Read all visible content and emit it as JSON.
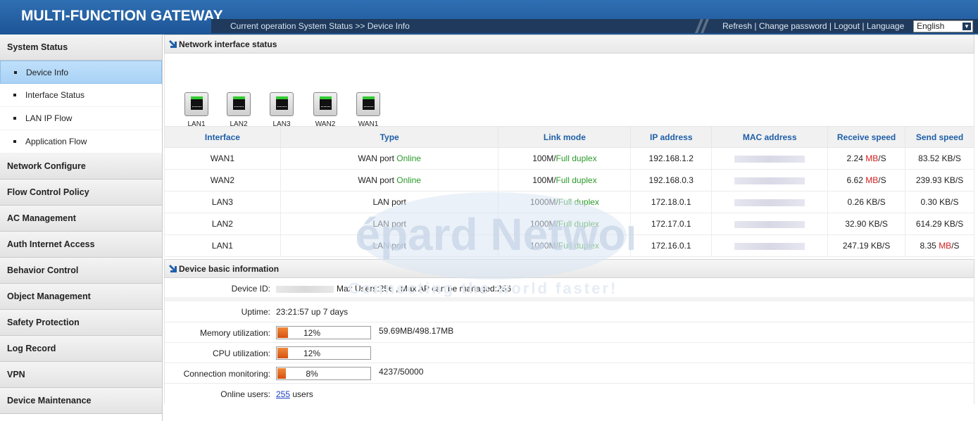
{
  "header": {
    "app_title": "MULTI-FUNCTION GATEWAY",
    "breadcrumb": "Current operation  System Status >> Device Info",
    "links": [
      "Refresh",
      "Change password",
      "Logout",
      "Language"
    ],
    "language_value": "English"
  },
  "sidebar": {
    "groups": [
      {
        "label": "System Status",
        "items": [
          "Device Info",
          "Interface Status",
          "LAN IP Flow",
          "Application Flow"
        ],
        "active": "Device Info"
      },
      {
        "label": "Network Configure"
      },
      {
        "label": "Flow Control Policy"
      },
      {
        "label": "AC Management"
      },
      {
        "label": "Auth Internet Access"
      },
      {
        "label": "Behavior Control"
      },
      {
        "label": "Object Management"
      },
      {
        "label": "Safety Protection"
      },
      {
        "label": "Log Record"
      },
      {
        "label": "VPN"
      },
      {
        "label": "Device Maintenance"
      }
    ]
  },
  "network_status": {
    "title": "Network interface status",
    "ports": [
      "LAN1",
      "LAN2",
      "LAN3",
      "WAN2",
      "WAN1"
    ],
    "columns": [
      "Interface",
      "Type",
      "Link mode",
      "IP address",
      "MAC address",
      "Receive speed",
      "Send speed"
    ],
    "rows": [
      {
        "iface": "WAN1",
        "type": "WAN port",
        "status": "Online",
        "speed": "100M/",
        "duplex": "Full duplex",
        "ip": "192.168.1.2",
        "rx_num": "2.24 ",
        "rx_unit": "MB",
        "rx_tail": "/S",
        "tx_num": "83.52 KB/S",
        "tx_unit": "",
        "tx_tail": ""
      },
      {
        "iface": "WAN2",
        "type": "WAN port",
        "status": "Online",
        "speed": "100M/",
        "duplex": "Full duplex",
        "ip": "192.168.0.3",
        "rx_num": "6.62 ",
        "rx_unit": "MB",
        "rx_tail": "/S",
        "tx_num": "239.93 KB/S",
        "tx_unit": "",
        "tx_tail": ""
      },
      {
        "iface": "LAN3",
        "type": "LAN port",
        "status": "",
        "speed": "1000M/",
        "duplex": "Full duplex",
        "ip": "172.18.0.1",
        "rx_num": "0.26 KB/S",
        "rx_unit": "",
        "rx_tail": "",
        "tx_num": "0.30 KB/S",
        "tx_unit": "",
        "tx_tail": ""
      },
      {
        "iface": "LAN2",
        "type": "LAN port",
        "status": "",
        "speed": "1000M/",
        "duplex": "Full duplex",
        "ip": "172.17.0.1",
        "rx_num": "32.90 KB/S",
        "rx_unit": "",
        "rx_tail": "",
        "tx_num": "614.29 KB/S",
        "tx_unit": "",
        "tx_tail": ""
      },
      {
        "iface": "LAN1",
        "type": "LAN port",
        "status": "",
        "speed": "1000M/",
        "duplex": "Full duplex",
        "ip": "172.16.0.1",
        "rx_num": "247.19 KB/S",
        "rx_unit": "",
        "rx_tail": "",
        "tx_num": "8.35 ",
        "tx_unit": "MB",
        "tx_tail": "/S"
      }
    ]
  },
  "device_info": {
    "title": "Device basic information",
    "device_id_label": "Device ID:",
    "device_id_extra": "Max Users:256 , Max AP can be managed:256",
    "uptime_label": "Uptime:",
    "uptime_value": "23:21:57 up 7 days",
    "memory_label": "Memory utilization:",
    "memory_pct": "12%",
    "memory_fraction": 0.12,
    "memory_detail": "59.69MB/498.17MB",
    "cpu_label": "CPU utilization:",
    "cpu_pct": "12%",
    "cpu_fraction": 0.12,
    "conn_label": "Connection monitoring:",
    "conn_pct": "8%",
    "conn_fraction": 0.08,
    "conn_detail": "4237/50000",
    "users_label": "Online users:",
    "users_count": "255",
    "users_suffix": "users"
  },
  "watermark": {
    "brand": "Guépard Networks",
    "tagline": "Connecting the world faster!"
  },
  "colors": {
    "accent": "#1f5fa8",
    "online": "#2a9a2a",
    "highlight": "#d21e1e",
    "bar": "#d65010"
  }
}
